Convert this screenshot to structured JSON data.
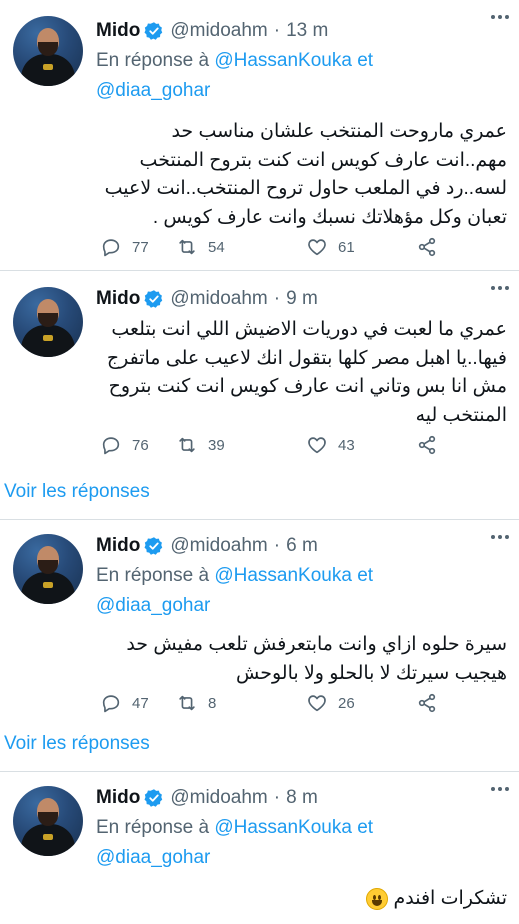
{
  "tweets": [
    {
      "name": "Mido",
      "handle": "@midoahm",
      "dot": "·",
      "time": "13 m",
      "reply_prefix": "En réponse à",
      "reply_mention_1": "@HassanKouka",
      "reply_and": "et",
      "reply_mention_2": "@diaa_gohar",
      "text": "عمري ماروحت المنتخب علشان مناسب حد مهم..انت عارف كويس انت كنت بتروح المنتخب لسه..رد في الملعب حاول تروح المنتخب..انت لاعيب تعبان وكل مؤهلاتك نسبك وانت عارف كويس .",
      "replies": "77",
      "retweets": "54",
      "likes": "61"
    },
    {
      "name": "Mido",
      "handle": "@midoahm",
      "dot": "·",
      "time": "9 m",
      "text": "عمري ما لعبت في دوريات الاضيش اللي انت بتلعب فيها..يا اهبل مصر كلها بتقول انك لاعيب على ماتفرج مش انا بس وتاني انت عارف كويس انت كنت بتروح المنتخب ليه",
      "replies": "76",
      "retweets": "39",
      "likes": "43",
      "see_replies": "Voir les réponses"
    },
    {
      "name": "Mido",
      "handle": "@midoahm",
      "dot": "·",
      "time": "6 m",
      "reply_prefix": "En réponse à",
      "reply_mention_1": "@HassanKouka",
      "reply_and": "et",
      "reply_mention_2": "@diaa_gohar",
      "text": "سيرة حلوه ازاي وانت مابتعرفش تلعب مفيش حد هيجيب سيرتك لا بالحلو ولا بالوحش",
      "replies": "47",
      "retweets": "8",
      "likes": "26",
      "see_replies": "Voir les réponses"
    },
    {
      "name": "Mido",
      "handle": "@midoahm",
      "dot": "·",
      "time": "8 m",
      "reply_prefix": "En réponse à",
      "reply_mention_1": "@HassanKouka",
      "reply_and": "et",
      "reply_mention_2": "@diaa_gohar",
      "text": "تشكرات افندم",
      "emoji": "grinning-face"
    }
  ],
  "colors": {
    "accent": "#1d9bf0",
    "muted": "#536471",
    "text": "#0f1419",
    "divider": "#d9dfe3"
  },
  "icons": [
    "verified-badge-icon",
    "more-icon",
    "reply-icon",
    "retweet-icon",
    "like-icon",
    "share-icon"
  ]
}
